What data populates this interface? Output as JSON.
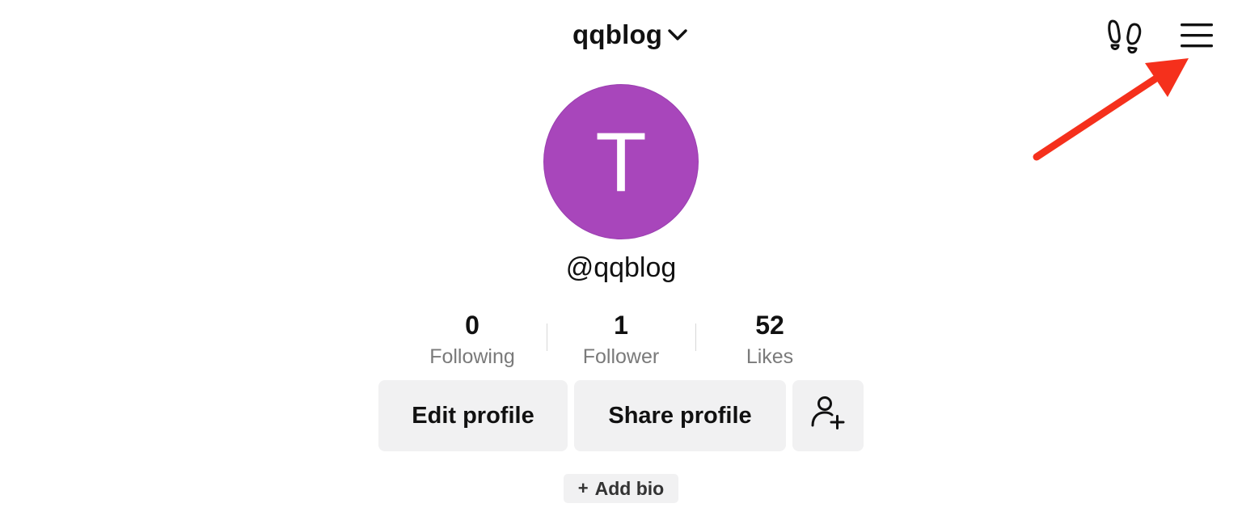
{
  "header": {
    "account_name": "qqblog",
    "icons": {
      "switcher": "chevron-down-icon",
      "visitors": "footprints-icon",
      "menu": "hamburger-menu-icon"
    }
  },
  "profile": {
    "avatar_letter": "T",
    "avatar_color": "#a846bb",
    "handle": "@qqblog"
  },
  "stats": [
    {
      "count": "0",
      "label": "Following"
    },
    {
      "count": "1",
      "label": "Follower"
    },
    {
      "count": "52",
      "label": "Likes"
    }
  ],
  "actions": {
    "edit_label": "Edit profile",
    "share_label": "Share profile",
    "add_friend_icon": "add-user-icon"
  },
  "bio": {
    "plus": "+",
    "label": "Add bio"
  },
  "colors": {
    "button_bg": "#f1f1f2",
    "annotation_arrow": "#f5301c"
  }
}
